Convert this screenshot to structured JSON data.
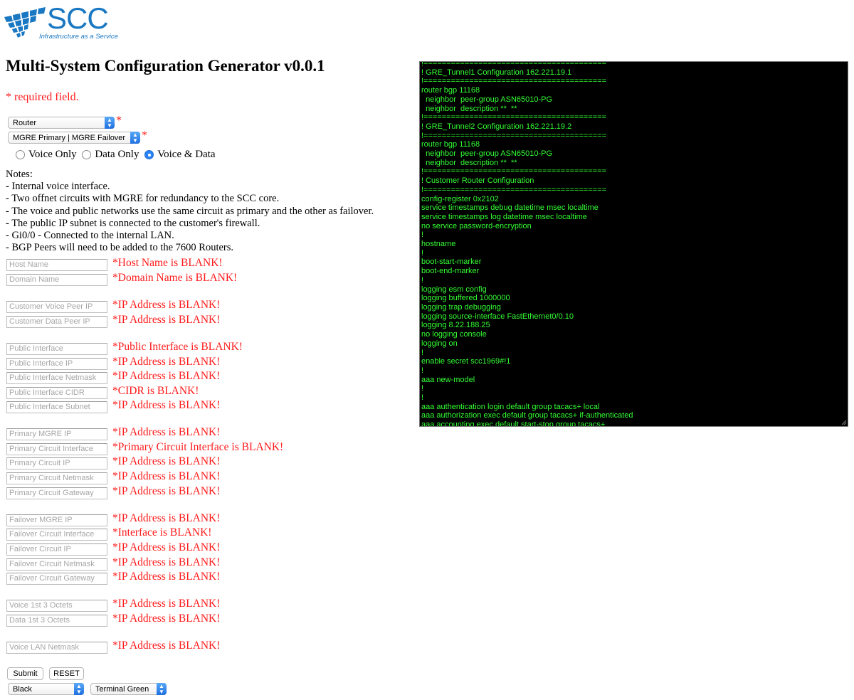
{
  "logo": {
    "brand": "SCC",
    "tagline": "Infrastructure as a Service"
  },
  "page_title": "Multi-System Configuration Generator v0.0.1",
  "required_note": "* required field.",
  "device_select": {
    "value": "Router",
    "required_mark": "*"
  },
  "topology_select": {
    "value": "MGRE Primary | MGRE Failover",
    "required_mark": "*"
  },
  "service_radios": [
    {
      "label": "Voice Only",
      "checked": false
    },
    {
      "label": "Data Only",
      "checked": false
    },
    {
      "label": "Voice & Data",
      "checked": true
    }
  ],
  "notes": [
    "Notes:",
    "- Internal voice interface.",
    "- Two offnet circuits with MGRE for redundancy to the SCC core.",
    "- The voice and public networks use the same circuit as primary and the other as failover.",
    "- The public IP subnet is connected to the customer's firewall.",
    "- Gi0/0 - Connected to the internal LAN.",
    "- BGP Peers will need to be added to the 7600 Routers."
  ],
  "fields": [
    {
      "placeholder": "Host Name",
      "error": "*Host Name is BLANK!"
    },
    {
      "placeholder": "Domain Name",
      "error": "*Domain Name is BLANK!"
    },
    {
      "placeholder": "Customer Voice Peer IP",
      "error": "*IP Address is BLANK!"
    },
    {
      "placeholder": "Customer Data Peer IP",
      "error": "*IP Address is BLANK!"
    },
    {
      "placeholder": "Public Interface",
      "error": "*Public Interface is BLANK!"
    },
    {
      "placeholder": "Public Interface IP",
      "error": "*IP Address is BLANK!"
    },
    {
      "placeholder": "Public Interface Netmask",
      "error": "*IP Address is BLANK!"
    },
    {
      "placeholder": "Public Interface CIDR",
      "error": "*CIDR is BLANK!"
    },
    {
      "placeholder": "Public Interface Subnet",
      "error": "*IP Address is BLANK!"
    },
    {
      "placeholder": "Primary MGRE IP",
      "error": "*IP Address is BLANK!"
    },
    {
      "placeholder": "Primary Circuit Interface",
      "error": "*Primary Circuit Interface is BLANK!"
    },
    {
      "placeholder": "Primary Circuit IP",
      "error": "*IP Address is BLANK!"
    },
    {
      "placeholder": "Primary Circuit Netmask",
      "error": "*IP Address is BLANK!"
    },
    {
      "placeholder": "Primary Circuit Gateway",
      "error": "*IP Address is BLANK!"
    },
    {
      "placeholder": "Failover MGRE IP",
      "error": "*IP Address is BLANK!"
    },
    {
      "placeholder": "Failover Circuit Interface",
      "error": "*Interface is BLANK!"
    },
    {
      "placeholder": "Failover Circuit IP",
      "error": "*IP Address is BLANK!"
    },
    {
      "placeholder": "Failover Circuit Netmask",
      "error": "*IP Address is BLANK!"
    },
    {
      "placeholder": "Failover Circuit Gateway",
      "error": "*IP Address is BLANK!"
    },
    {
      "placeholder": "Voice 1st 3 Octets",
      "error": "*IP Address is BLANK!"
    },
    {
      "placeholder": "Data 1st 3 Octets",
      "error": "*IP Address is BLANK!"
    },
    {
      "placeholder": "Voice LAN Netmask",
      "error": "*IP Address is BLANK!"
    }
  ],
  "buttons": {
    "submit": "Submit",
    "reset": "RESET"
  },
  "background_select": {
    "value": "Black"
  },
  "font_color_select": {
    "value": "Terminal Green"
  },
  "terminal": {
    "background": "#000000",
    "text_color": "#33ff33",
    "lines": [
      "!========================================",
      "! GRE_Tunnel1 Configuration 162.221.19.1",
      "!========================================",
      "router bgp 11168",
      "  neighbor  peer-group ASN65010-PG",
      "  neighbor  description **  **",
      "!========================================",
      "! GRE_Tunnel2 Configuration 162.221.19.2",
      "!========================================",
      "router bgp 11168",
      "  neighbor  peer-group ASN65010-PG",
      "  neighbor  description **  **",
      "!========================================",
      "! Customer Router Configuration",
      "!========================================",
      "config-register 0x2102",
      "service timestamps debug datetime msec localtime",
      "service timestamps log datetime msec localtime",
      "no service password-encryption",
      "!",
      "hostname",
      "!",
      "boot-start-marker",
      "boot-end-marker",
      "!",
      "logging esm config",
      "logging buffered 1000000",
      "logging trap debugging",
      "logging source-interface FastEthernet0/0.10",
      "logging 8.22.188.25",
      "no logging console",
      "logging on",
      "!",
      "enable secret scc1969#!1",
      "!",
      "aaa new-model",
      "!",
      "!",
      "aaa authentication login default group tacacs+ local",
      "aaa authorization exec default group tacacs+ if-authenticated",
      "aaa accounting exec default start-stop group tacacs+"
    ]
  },
  "colors": {
    "error": "#ff1a1a",
    "brand": "#1a78c2",
    "select_arrow": "#2b84f4"
  }
}
